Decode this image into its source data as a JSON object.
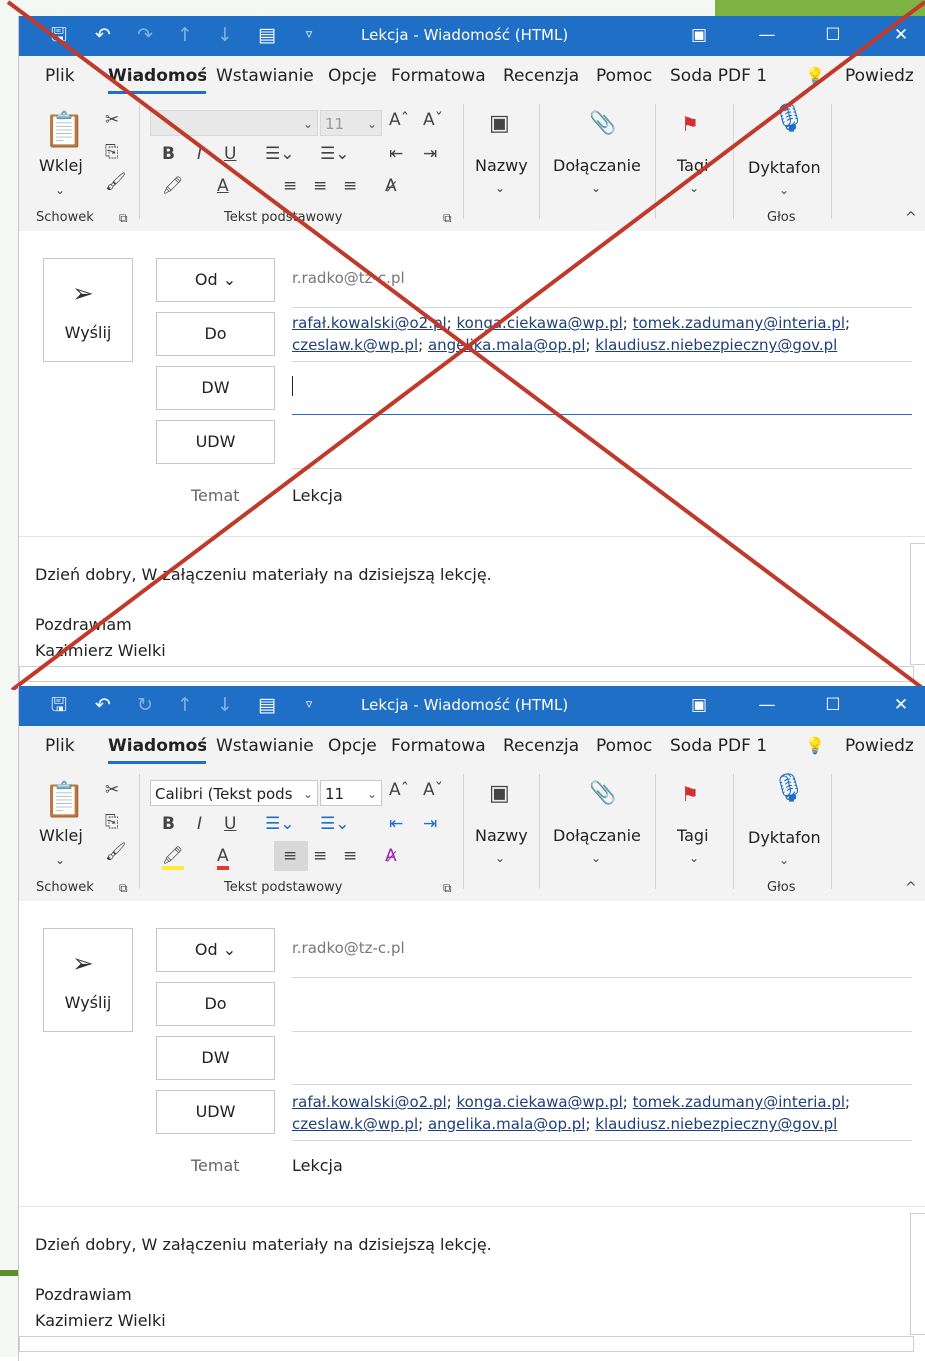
{
  "windows": [
    {
      "id": "incorrect",
      "title": "Lekcja  -  Wiadomość (HTML)",
      "tabs": [
        "Plik",
        "Wiadomość",
        "Wstawianie",
        "Opcje",
        "Formatowa",
        "Recenzja",
        "Pomoc",
        "Soda PDF 1"
      ],
      "tell_me": "Powiedz",
      "ribbon": {
        "paste_label": "Wklej",
        "clipboard_group": "Schowek",
        "font_name": "",
        "font_size": "11",
        "basic_text_group": "Tekst podstawowy",
        "names_label": "Nazwy",
        "attach_label": "Dołączanie",
        "tags_label": "Tagi",
        "dictate_label": "Dyktafon",
        "voice_group": "Głos"
      },
      "send_label": "Wyślij",
      "from_label": "Od",
      "from_value": "r.radko@tz-c.pl",
      "to_label": "Do",
      "cc_label": "DW",
      "bcc_label": "UDW",
      "subject_label": "Temat",
      "subject_value": "Lekcja",
      "to_line1": [
        "rafał.kowalski@o2.pl",
        "konga.ciekawa@wp.pl",
        "tomek.zadumany@interia.pl"
      ],
      "to_line2": [
        "czeslaw.k@wp.pl",
        "angelika.mala@op.pl",
        "klaudiusz.niebezpieczny@gov.pl"
      ],
      "cc_value": "",
      "bcc_value": "",
      "body": [
        "Dzień dobry, W załączeniu materiały na dzisiejszą lekcję.",
        "Pozdrawiam",
        "Kazimierz Wielki"
      ]
    },
    {
      "id": "correct",
      "title": "Lekcja  -  Wiadomość (HTML)",
      "tabs": [
        "Plik",
        "Wiadomość",
        "Wstawianie",
        "Opcje",
        "Formatowa",
        "Recenzja",
        "Pomoc",
        "Soda PDF 1"
      ],
      "tell_me": "Powiedz",
      "ribbon": {
        "paste_label": "Wklej",
        "clipboard_group": "Schowek",
        "font_name": "Calibri (Tekst pods",
        "font_size": "11",
        "basic_text_group": "Tekst podstawowy",
        "names_label": "Nazwy",
        "attach_label": "Dołączanie",
        "tags_label": "Tagi",
        "dictate_label": "Dyktafon",
        "voice_group": "Głos"
      },
      "send_label": "Wyślij",
      "from_label": "Od",
      "from_value": "r.radko@tz-c.pl",
      "to_label": "Do",
      "cc_label": "DW",
      "bcc_label": "UDW",
      "subject_label": "Temat",
      "subject_value": "Lekcja",
      "to_line1": [],
      "to_line2": [],
      "cc_value": "",
      "bcc_line1": [
        "rafał.kowalski@o2.pl",
        "konga.ciekawa@wp.pl",
        "tomek.zadumany@interia.pl"
      ],
      "bcc_line2": [
        "czeslaw.k@wp.pl",
        "angelika.mala@op.pl",
        "klaudiusz.niebezpieczny@gov.pl"
      ],
      "body": [
        "Dzień dobry, W załączeniu materiały na dzisiejszą lekcję.",
        "Pozdrawiam",
        "Kazimierz Wielki"
      ]
    }
  ],
  "colors": {
    "titlebar": "#1e6fc5",
    "cross": "#c0392b",
    "link": "#1f3f7a"
  }
}
